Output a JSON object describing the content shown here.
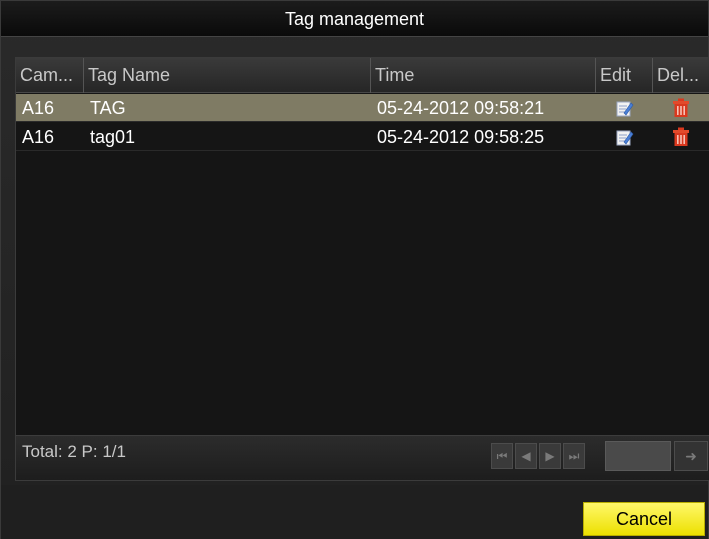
{
  "dialog": {
    "title": "Tag management"
  },
  "table": {
    "columns": [
      "Cam...",
      "Tag Name",
      "Time",
      "Edit",
      "Del..."
    ],
    "rows": [
      {
        "camera": "A16",
        "tag_name": "TAG",
        "time": "05-24-2012 09:58:21",
        "edit_icon": "edit-icon",
        "delete_icon": "trash-icon",
        "selected": true
      },
      {
        "camera": "A16",
        "tag_name": "tag01",
        "time": "05-24-2012 09:58:25",
        "edit_icon": "edit-icon",
        "delete_icon": "trash-icon",
        "selected": false
      }
    ]
  },
  "footer": {
    "summary": "Total: 2 P: 1/1",
    "pager": {
      "first_icon": "first-page-icon",
      "prev_icon": "prev-page-icon",
      "next_icon": "next-page-icon",
      "last_icon": "last-page-icon",
      "page_input_value": "",
      "go_icon": "go-arrow-icon"
    }
  },
  "actions": {
    "cancel_label": "Cancel"
  },
  "colors": {
    "selected_row": "#7f7b64",
    "cancel_button": "#f4ea2a",
    "delete_icon": "#d9381e"
  }
}
